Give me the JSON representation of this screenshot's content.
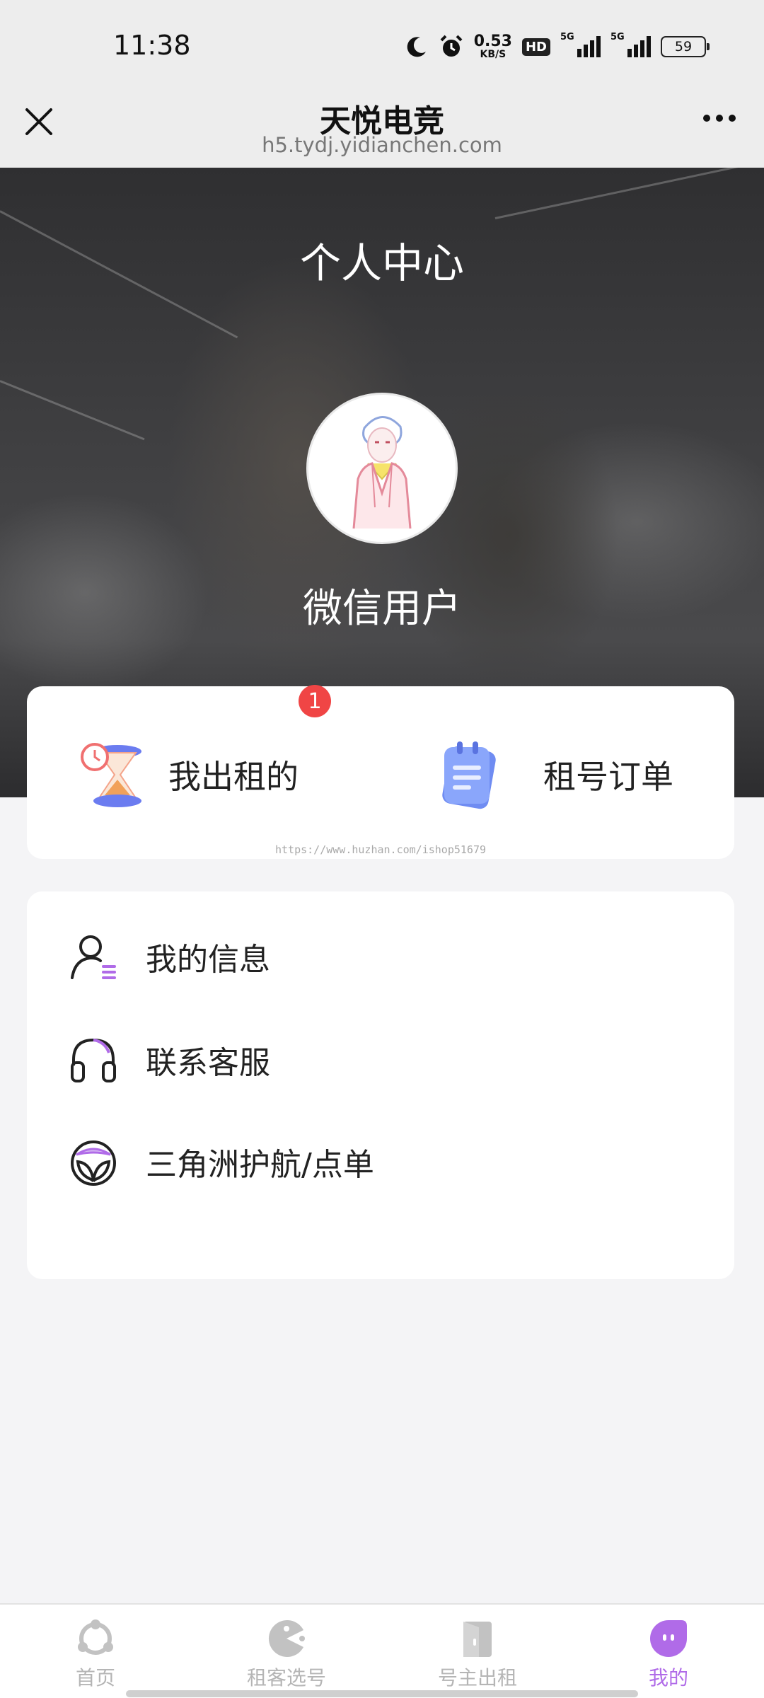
{
  "status_bar": {
    "time": "11:38",
    "net_speed_value": "0.53",
    "net_speed_unit": "KB/S",
    "hd_label": "HD",
    "signal1_label": "5G",
    "signal2_label": "5G",
    "battery": "59",
    "icons": [
      "moon-icon",
      "alarm-icon",
      "signal-icon",
      "battery-icon"
    ]
  },
  "nav": {
    "title": "天悦电竞",
    "url": "h5.tydj.yidianchen.com"
  },
  "hero": {
    "title": "个人中心",
    "user_name": "微信用户"
  },
  "quick": {
    "rent_out_label": "我出租的",
    "rent_out_badge": "1",
    "orders_label": "租号订单",
    "watermark": "https://www.huzhan.com/ishop51679"
  },
  "menu": {
    "items": [
      {
        "label": "我的信息",
        "icon": "user-info-icon"
      },
      {
        "label": "联系客服",
        "icon": "headset-icon"
      },
      {
        "label": "三角洲护航/点单",
        "icon": "shield-leaf-icon"
      }
    ]
  },
  "tabs": [
    {
      "label": "首页",
      "icon": "home-icon",
      "active": false
    },
    {
      "label": "租客选号",
      "icon": "pacman-icon",
      "active": false
    },
    {
      "label": "号主出租",
      "icon": "door-icon",
      "active": false
    },
    {
      "label": "我的",
      "icon": "profile-face-icon",
      "active": true
    }
  ],
  "colors": {
    "accent": "#b06be8",
    "badge": "#f04545",
    "background": "#f4f4f6"
  }
}
